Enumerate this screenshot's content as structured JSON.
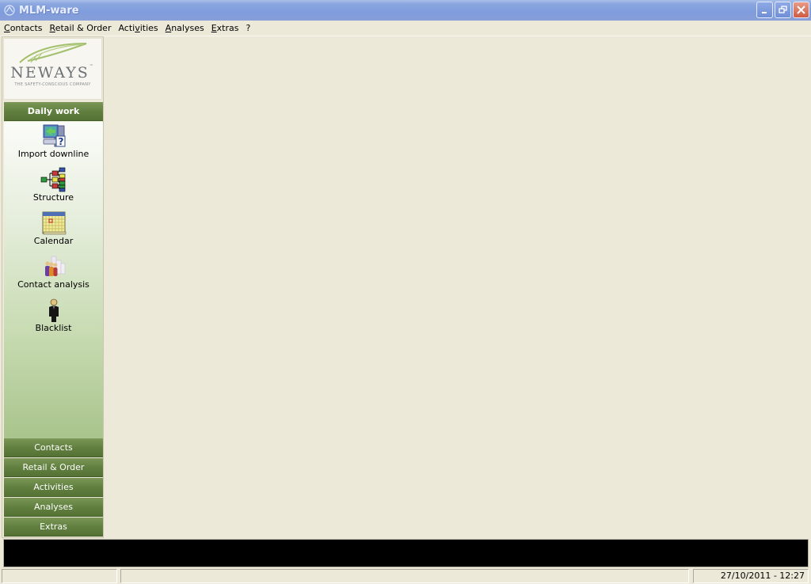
{
  "window": {
    "title": "MLM-ware",
    "app_icon": "mlm-ware-logo-icon",
    "controls": {
      "minimize": "minimize-icon",
      "restore": "restore-icon",
      "close": "close-icon"
    }
  },
  "menubar": {
    "items": [
      {
        "label": "Contacts",
        "accel": "C",
        "rest": "ontacts"
      },
      {
        "label": "Retail & Order",
        "accel": "R",
        "rest": "etail & Order"
      },
      {
        "label": "Activities",
        "pre": "Acti",
        "accel": "v",
        "rest": "ities"
      },
      {
        "label": "Analyses",
        "accel": "A",
        "rest": "nalyses"
      },
      {
        "label": "Extras",
        "accel": "E",
        "rest": "xtras"
      },
      {
        "label": "?"
      }
    ]
  },
  "sidebar": {
    "logo": {
      "brand": "NEWAYS",
      "trademark": "™",
      "tagline": "THE SAFETY-CONSCIOUS COMPANY"
    },
    "active_group": "Daily work",
    "tools": [
      {
        "label": "Import downline",
        "icon": "import-computer-icon"
      },
      {
        "label": "Structure",
        "icon": "tree-structure-icon"
      },
      {
        "label": "Calendar",
        "icon": "calendar-icon"
      },
      {
        "label": "Contact analysis",
        "icon": "people-chart-icon"
      },
      {
        "label": "Blacklist",
        "icon": "black-person-icon"
      }
    ],
    "groups": [
      "Contacts",
      "Retail & Order",
      "Activities",
      "Analyses",
      "Extras"
    ]
  },
  "statusbar": {
    "cell1": "",
    "cell2": "",
    "datetime": "27/10/2011 - 12:27"
  },
  "colors": {
    "titlebar": "#8aa6e0",
    "group_header": "#61803f",
    "panel_bg": "#ece9d8",
    "output_bg": "#000000"
  }
}
